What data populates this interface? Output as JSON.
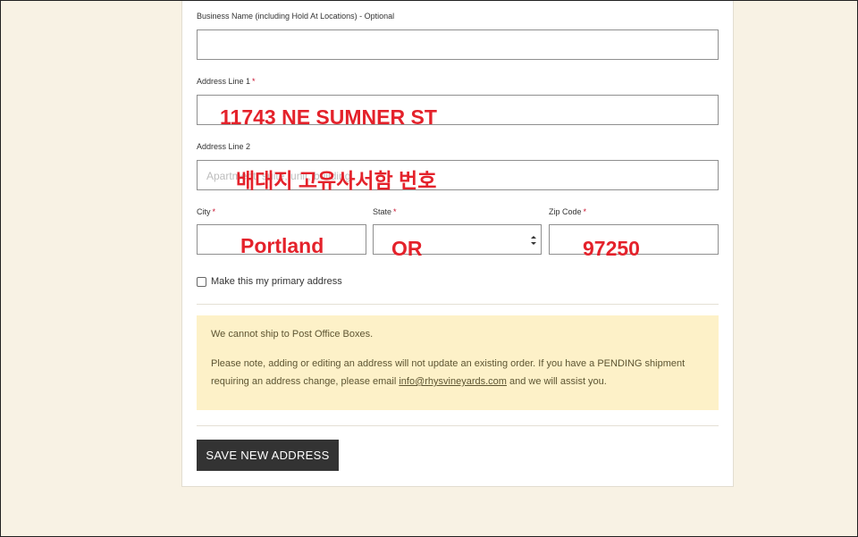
{
  "form": {
    "business_name": {
      "label": "Business Name (including Hold At Locations) - Optional",
      "value": ""
    },
    "address_line1": {
      "label": "Address Line 1",
      "required_mark": "*",
      "annotation": "11743 NE SUMNER ST"
    },
    "address_line2": {
      "label": "Address Line 2",
      "placeholder": "Apartment, suite, unit, building",
      "annotation": "배대지 고유사서함 번호"
    },
    "city": {
      "label": "City",
      "required_mark": "*",
      "annotation": "Portland"
    },
    "state": {
      "label": "State",
      "required_mark": "*",
      "annotation": "OR"
    },
    "zip": {
      "label": "Zip Code",
      "required_mark": "*",
      "annotation": "97250"
    },
    "primary_checkbox": {
      "label": "Make this my primary address",
      "checked": false
    }
  },
  "notice": {
    "line1": "We cannot ship to Post Office Boxes.",
    "line2": "Please note, adding or editing an address will not update an existing order. If you have a PENDING shipment",
    "line3_prefix": "requiring an address change, please email ",
    "email": "info@rhysvineyards.com",
    "line3_suffix": " and we will assist you."
  },
  "actions": {
    "save_label": "SAVE NEW ADDRESS"
  },
  "colors": {
    "background": "#f8f2e4",
    "notice_bg": "#fdf1c8",
    "button_bg": "#333333",
    "annotation": "#e4222b",
    "required": "#c8102e"
  },
  "icons": {
    "select_arrow": "updown-chevron-icon"
  }
}
